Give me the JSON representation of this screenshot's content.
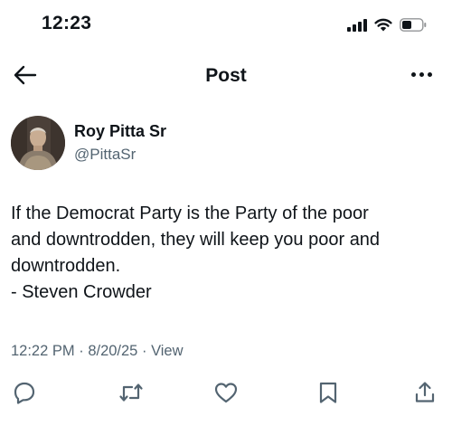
{
  "status_bar": {
    "time": "12:23",
    "icons": [
      "cellular-signal-icon",
      "wifi-icon",
      "battery-icon"
    ]
  },
  "nav": {
    "title": "Post",
    "back_icon": "arrow-left-icon",
    "more_icon": "more-horizontal-icon"
  },
  "author": {
    "name": "Roy Pitta Sr",
    "handle": "@PittaSr"
  },
  "post": {
    "lines": [
      "If the Democrat Party is the Party of the poor",
      "and downtrodden, they will keep you poor and",
      "downtrodden.",
      "- Steven Crowder"
    ],
    "time": "12:22 PM",
    "date": "8/20/25",
    "separator": "·",
    "view_label": "View"
  },
  "actions": [
    "reply-icon",
    "repost-icon",
    "like-icon",
    "bookmark-icon",
    "share-icon"
  ],
  "colors": {
    "text": "#0f1419",
    "secondary": "#536471",
    "icon": "#536471",
    "background": "#ffffff"
  }
}
